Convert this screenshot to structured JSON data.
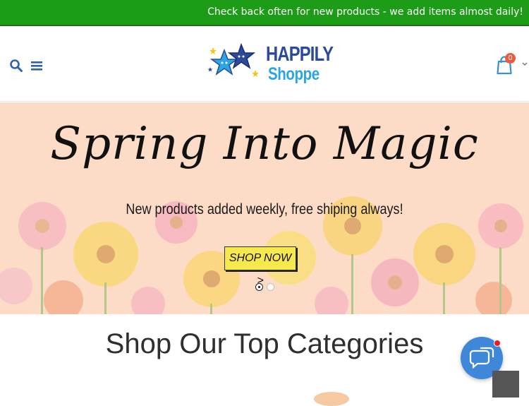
{
  "announcement": {
    "text": "Check back often for new products - we add items almost daily!"
  },
  "header": {
    "logo": {
      "line1": "HAPPILY",
      "line2": "Shoppe"
    },
    "cart": {
      "count": "0"
    },
    "icons": {
      "search": "search-icon",
      "menu": "hamburger-icon",
      "cart": "cart-icon",
      "account_toggle": "chevron-down-icon"
    }
  },
  "hero": {
    "title": "Spring Into Magic",
    "subtitle": "New products added weekly, free shiping always!",
    "cta_label": "SHOP NOW >",
    "slides_total": 2,
    "active_slide": 1
  },
  "categories": {
    "heading": "Shop Our Top Categories"
  },
  "widgets": {
    "chat": "chat-bubbles-icon",
    "scroll_top": "scroll-top-button"
  },
  "colors": {
    "announcement_bg": "#1d9c18",
    "brand_blue": "#2b4a9b",
    "brand_light_blue": "#2ba6e0",
    "hero_bg": "#fcdcc6",
    "cta_bg": "#f7e84d",
    "chat_bg": "#3f87d9",
    "cart_badge": "#f05a3c"
  }
}
